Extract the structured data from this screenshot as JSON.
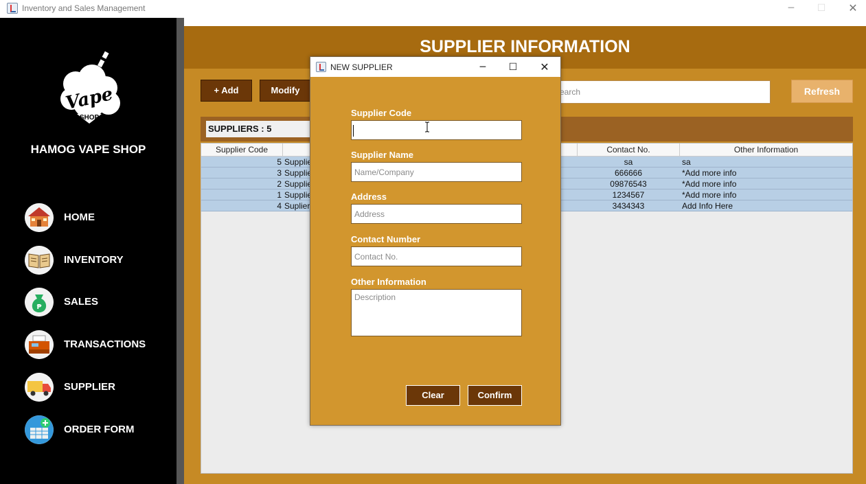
{
  "window": {
    "title": "Inventory and Sales Management",
    "min": "─",
    "max": "☐",
    "close": "✕"
  },
  "sidebar": {
    "brand": "HAMOG VAPE SHOP",
    "logo_text": "Vape",
    "logo_subtext": "SHOP",
    "items": [
      {
        "label": "HOME",
        "icon": "home-icon"
      },
      {
        "label": "INVENTORY",
        "icon": "inventory-icon"
      },
      {
        "label": "SALES",
        "icon": "sales-icon"
      },
      {
        "label": "TRANSACTIONS",
        "icon": "transactions-icon"
      },
      {
        "label": "SUPPLIER",
        "icon": "supplier-icon"
      },
      {
        "label": "ORDER FORM",
        "icon": "order-form-icon"
      }
    ]
  },
  "main": {
    "title": "SUPPLIER INFORMATION",
    "add_label": "+ Add",
    "modify_label": "Modify",
    "search_placeholder": "earch",
    "refresh_label": "Refresh",
    "count_label": "SUPPLIERS :  5",
    "columns": [
      "Supplier Code",
      "Contact No.",
      "Other Information"
    ],
    "rows": [
      {
        "code": "5",
        "name": "Supplie",
        "contact": "sa",
        "info": "sa"
      },
      {
        "code": "3",
        "name": "Supplie",
        "contact": "666666",
        "info": "*Add more info"
      },
      {
        "code": "2",
        "name": "Supplie",
        "contact": "09876543",
        "info": "*Add more info"
      },
      {
        "code": "1",
        "name": "Supplie",
        "contact": "1234567",
        "info": "*Add more info"
      },
      {
        "code": "4",
        "name": "Suplier",
        "contact": "3434343",
        "info": "Add Info Here"
      }
    ]
  },
  "dialog": {
    "title": "NEW SUPPLIER",
    "min": "─",
    "max": "☐",
    "close": "✕",
    "fields": {
      "code_label": "Supplier Code",
      "code_value": "",
      "name_label": "Supplier Name",
      "name_placeholder": "Name/Company",
      "address_label": "Address",
      "address_placeholder": "Address",
      "contact_label": "Contact Number",
      "contact_placeholder": "Contact No.",
      "info_label": "Other Information",
      "info_placeholder": "Description"
    },
    "clear_label": "Clear",
    "confirm_label": "Confirm"
  },
  "colors": {
    "accent": "#c68a25",
    "header": "#a76b10",
    "button_dark": "#6b3708",
    "dialog_bg": "#d2962e",
    "row_selected": "#b8cfe5"
  }
}
